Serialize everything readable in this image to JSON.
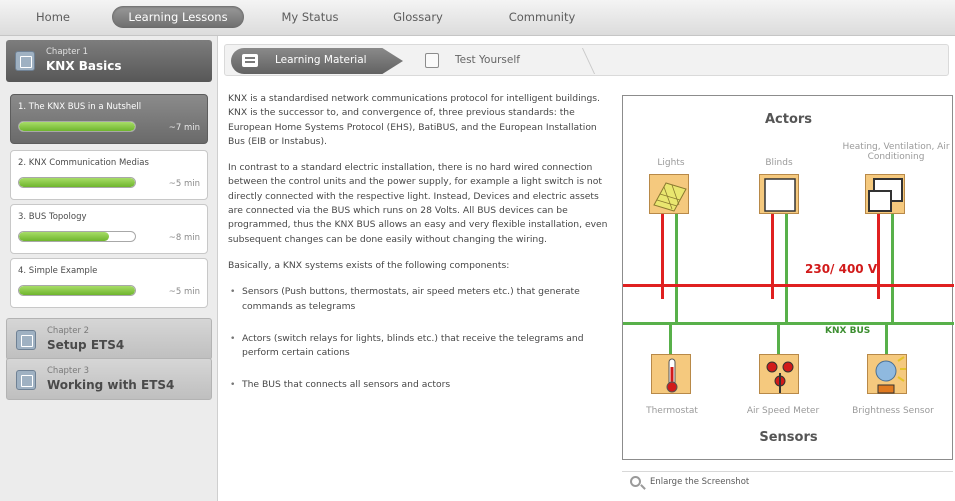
{
  "nav": {
    "tabs": [
      "Home",
      "Learning Lessons",
      "My Status",
      "Glossary",
      "Community"
    ],
    "active": "Learning Lessons"
  },
  "sidebar": {
    "chapter1": {
      "small": "Chapter 1",
      "title": "KNX Basics"
    },
    "lessons": [
      {
        "title": "1. The KNX BUS in a Nutshell",
        "duration": "~7 min",
        "progress": 1.0
      },
      {
        "title": "2. KNX Communication Medias",
        "duration": "~5 min",
        "progress": 1.0
      },
      {
        "title": "3. BUS Topology",
        "duration": "~8 min",
        "progress": 0.78
      },
      {
        "title": "4. Simple Example",
        "duration": "~5 min",
        "progress": 1.0
      }
    ],
    "chapter2": {
      "small": "Chapter 2",
      "title": "Setup ETS4"
    },
    "chapter3": {
      "small": "Chapter 3",
      "title": "Working with ETS4"
    }
  },
  "content_tabs": {
    "learning": "Learning Material",
    "test": "Test Yourself"
  },
  "content": {
    "p1": "KNX is a standardised network communications protocol for intelligent buildings. KNX is the successor to, and convergence of, three previous standards: the European Home Systems Protocol (EHS), BatiBUS, and the European Installation Bus (EIB or Instabus).",
    "p2": "In contrast to a standard electric installation, there is no hard wired connection between the control units and the power supply, for example a light switch is not directly connected with the respective light. Instead, Devices and electric assets are connected via the BUS which runs on 28 Volts. All BUS devices can be programmed, thus the KNX BUS allows an easy and very flexible installation, even subsequent changes can be done easily without changing the wiring.",
    "p3": "Basically, a KNX systems exists of the following components:",
    "bullets": [
      "Sensors (Push buttons, thermostats, air speed meters etc.) that generate commands as telegrams",
      "Actors (switch relays for lights, blinds etc.) that receive the telegrams and perform certain cations",
      "The BUS that connects all sensors and actors"
    ]
  },
  "diagram": {
    "actors_heading": "Actors",
    "actors": [
      "Lights",
      "Blinds",
      "Heating, Ventilation, Air Conditioning"
    ],
    "power_label": "230/ 400 V",
    "bus_label": "KNX BUS",
    "sensors": [
      "Thermostat",
      "Air Speed Meter",
      "Brightness Sensor"
    ],
    "sensors_heading": "Sensors",
    "colors": {
      "power_line": "#e02020",
      "bus_line": "#58b04a",
      "box_fill": "#f5c97e"
    }
  },
  "enlarge": {
    "label": "Enlarge the Screenshot"
  }
}
